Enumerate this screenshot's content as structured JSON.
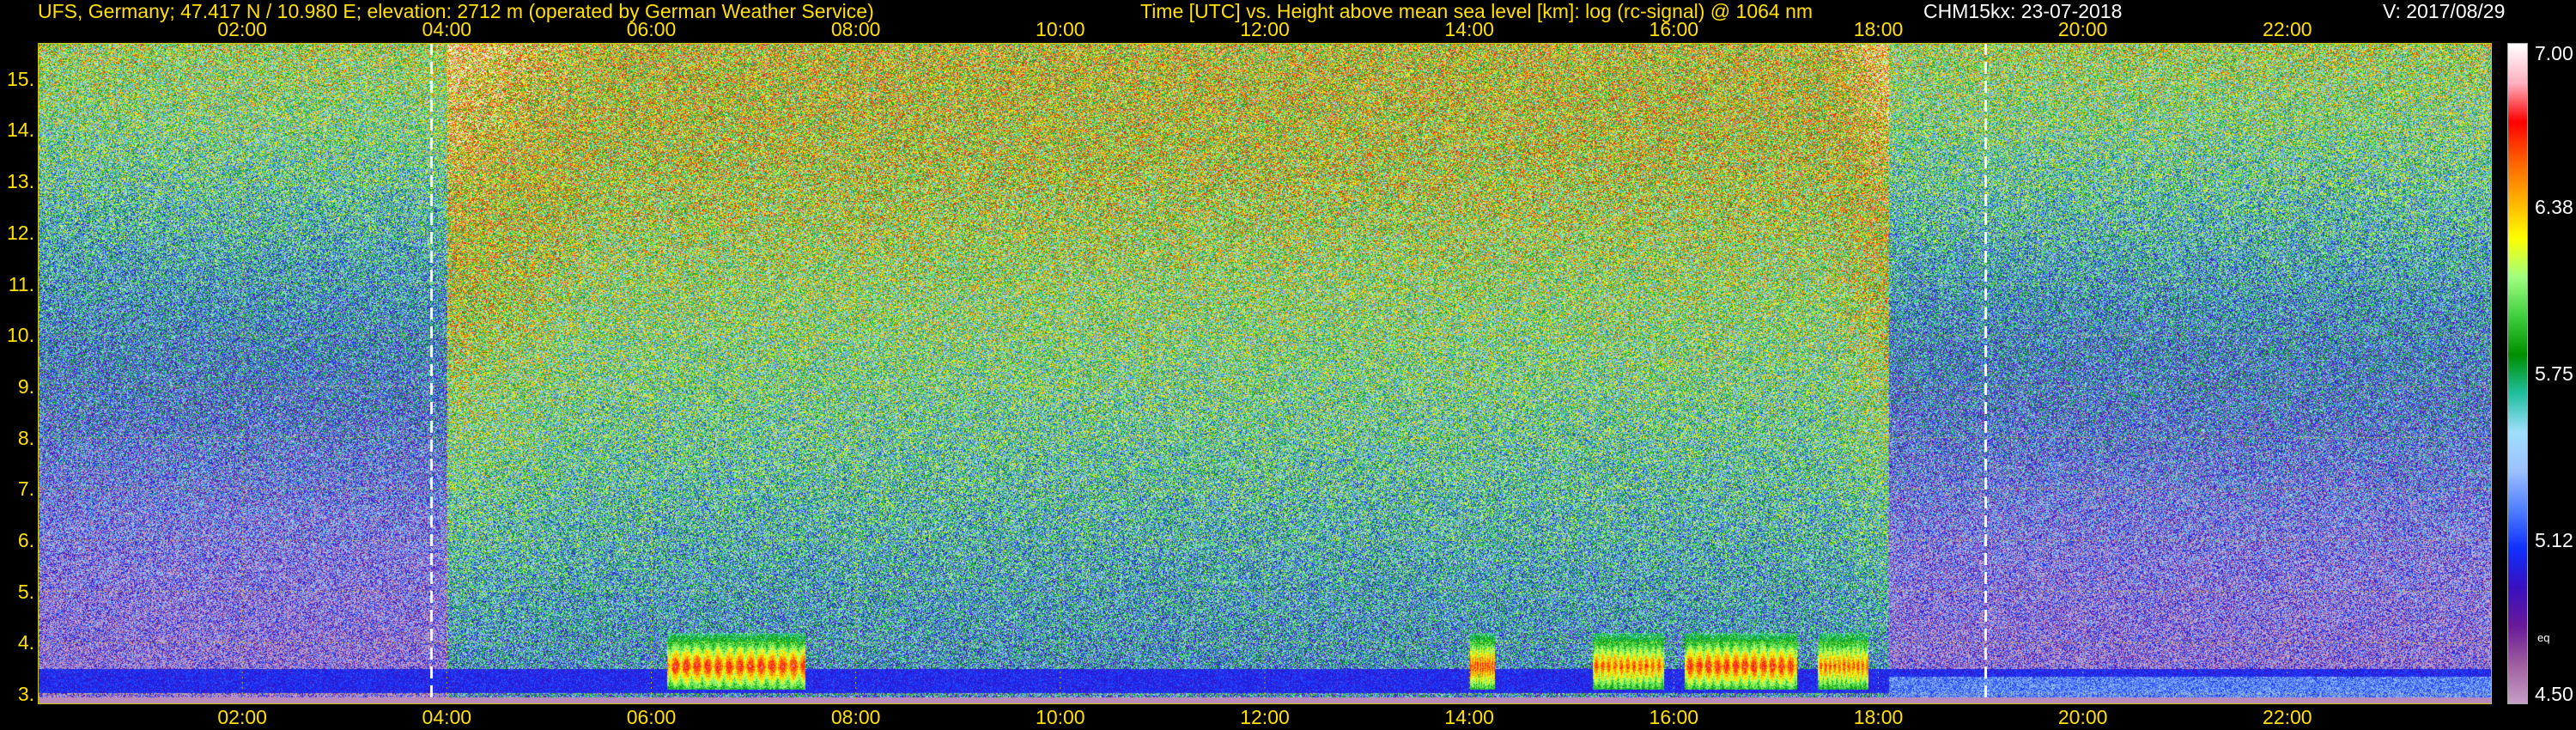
{
  "header": {
    "left": "UFS, Germany; 47.417 N / 10.980 E; elevation: 2712 m  (operated by German Weather Service)",
    "center": "Time [UTC] vs. Height above mean sea level [km]: log (rc-signal) @ 1064 nm",
    "instrument": "CHM15kx: 23-07-2018",
    "version": "V: 2017/08/29"
  },
  "colors": {
    "title": "#ffe000",
    "header_right": "#ffffff",
    "grid": "#c8c800",
    "marker": "#ffffff"
  },
  "chart_data": {
    "type": "heatmap",
    "title": "Time [UTC] vs. Height above mean sea level [km]: log (rc-signal) @ 1064 nm",
    "xlabel": "Time [UTC]",
    "ylabel": "Height above mean sea level [km]",
    "x_ticks": [
      "02:00",
      "04:00",
      "06:00",
      "08:00",
      "10:00",
      "12:00",
      "14:00",
      "16:00",
      "18:00",
      "20:00",
      "22:00"
    ],
    "x_tick_hours": [
      2,
      4,
      6,
      8,
      10,
      12,
      14,
      16,
      18,
      20,
      22
    ],
    "xlim_hours": [
      0,
      24
    ],
    "y_ticks": [
      "3.",
      "4.",
      "5.",
      "6.",
      "7.",
      "8.",
      "9.",
      "10.",
      "11.",
      "12.",
      "13.",
      "14.",
      "15."
    ],
    "y_tick_values": [
      3,
      4,
      5,
      6,
      7,
      8,
      9,
      10,
      11,
      12,
      13,
      14,
      15
    ],
    "ylim_km": [
      2.8,
      15.7
    ],
    "colorbar": {
      "range": [
        4.5,
        7.0
      ],
      "labels": [
        "7.00",
        "6.38",
        "5.75",
        "5.12",
        "4.50"
      ],
      "label_values": [
        7.0,
        6.38,
        5.75,
        5.12,
        4.5
      ],
      "unit_label": "eq",
      "stops": [
        "#c8a0c8",
        "#a060a0",
        "#6a1a9a",
        "#3a10c0",
        "#1030ff",
        "#5080ff",
        "#9cc0ff",
        "#a0e0ff",
        "#20c0a0",
        "#009000",
        "#40d040",
        "#a0ff80",
        "#ffff00",
        "#ffb000",
        "#ff6000",
        "#ff0000",
        "#ffb0c0",
        "#ffffff"
      ]
    },
    "markers_hours": [
      3.85,
      19.05
    ],
    "grid": true,
    "notes": [
      "aerosol layer 3.0-3.5 km",
      "convective cloud bursts 06:15-07:40 and 14:00-18:00"
    ]
  }
}
